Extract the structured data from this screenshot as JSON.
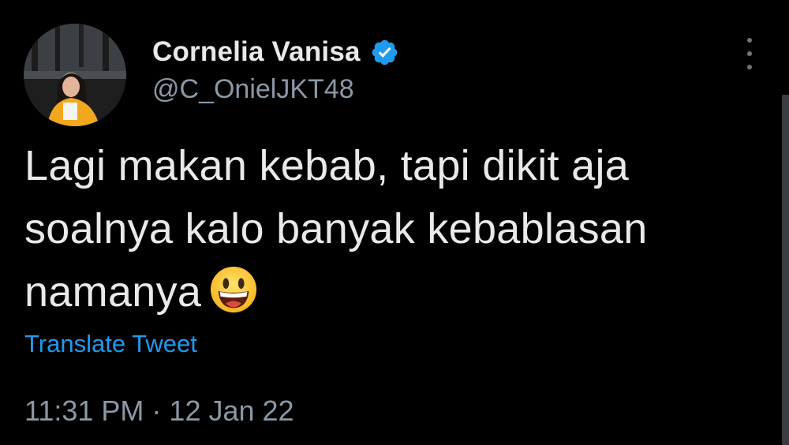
{
  "tweet": {
    "author": {
      "display_name": "Cornelia Vanisa",
      "handle": "@C_OnielJKT48",
      "verified": true
    },
    "text_lines": [
      "Lagi makan kebab, tapi dikit aja",
      "soalnya kalo banyak kebablasan",
      "namanya"
    ],
    "emoji": "grinning-face-emoji",
    "translate_label": "Translate Tweet",
    "time": "11:31 PM",
    "separator": "·",
    "date": "12 Jan 22"
  },
  "icons": {
    "verified": "verified-badge-icon",
    "more": "more-vertical-icon"
  },
  "colors": {
    "background": "#000000",
    "text_primary": "#e7e9ea",
    "text_secondary": "#8b98a5",
    "link": "#1d9bf0",
    "verified_badge": "#1d9bf0"
  }
}
